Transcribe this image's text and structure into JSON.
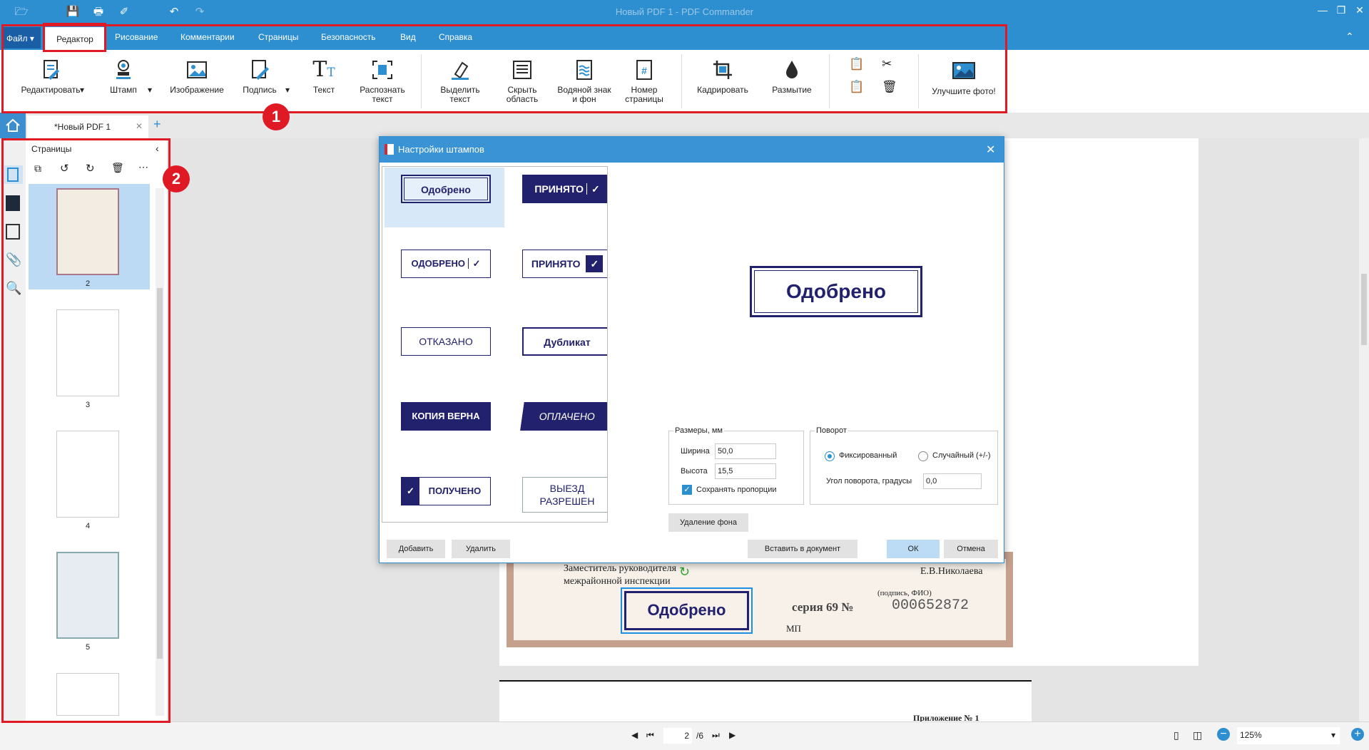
{
  "app": {
    "title": "Новый PDF 1 - PDF Commander"
  },
  "menu": {
    "file": "Файл",
    "items": [
      "Редактор",
      "Рисование",
      "Комментарии",
      "Страницы",
      "Безопасность",
      "Вид",
      "Справка"
    ]
  },
  "ribbon": {
    "edit": "Редактировать",
    "stamp": "Штамп",
    "image": "Изображение",
    "signature": "Подпись",
    "text": "Текст",
    "ocr": [
      "Распознать",
      "текст"
    ],
    "highlight": [
      "Выделить",
      "текст"
    ],
    "hide": [
      "Скрыть",
      "область"
    ],
    "watermark": [
      "Водяной знак",
      "и фон"
    ],
    "pagenum": [
      "Номер",
      "страницы"
    ],
    "crop": "Кадрировать",
    "blur": "Размытие",
    "enhance": "Улучшите фото!"
  },
  "annotations": {
    "one": "1",
    "two": "2"
  },
  "tab": {
    "name": "*Новый PDF 1"
  },
  "panel": {
    "title": "Страницы",
    "pages": [
      "2",
      "3",
      "4",
      "5"
    ]
  },
  "dialog": {
    "title": "Настройки штампов",
    "stamps": [
      "Одобрено",
      "ПРИНЯТО",
      "ОДОБРЕНО",
      "ПРИНЯТО",
      "ОТКАЗАНО",
      "Дубликат",
      "КОПИЯ ВЕРНА",
      "ОПЛАЧЕНО",
      "ПОЛУЧЕНО",
      "ВЫЕЗД РАЗРЕШЕН"
    ],
    "preview": "Одобрено",
    "sizes": {
      "legend": "Размеры, мм",
      "width_label": "Ширина",
      "width": "50,0",
      "height_label": "Высота",
      "height": "15,5",
      "keep": "Сохранять пропорции",
      "keep_checked": true
    },
    "rotation": {
      "legend": "Поворот",
      "fixed": "Фиксированный",
      "random": "Случайный (+/-)",
      "angle_label": "Угол поворота, градусы",
      "angle": "0,0",
      "selected": "fixed"
    },
    "buttons": {
      "remove_bg": "Удаление фона",
      "add": "Добавить",
      "delete": "Удалить",
      "insert": "Вставить в документ",
      "ok": "ОК",
      "cancel": "Отмена"
    }
  },
  "document": {
    "line1": "Заместитель руководителя",
    "line2": "межрайонной инспекции",
    "name": "Е.В.Николаева",
    "sig_hint": "(подпись, ФИО)",
    "seria": "серия 69 №",
    "number": "000652872",
    "mp": "МП",
    "placed_stamp": "Одобрено",
    "appendix": "Приложение № 1"
  },
  "status": {
    "page": "2",
    "total": "/6",
    "zoom": "125%"
  },
  "colors": {
    "accent": "#2e8fd0",
    "stamp": "#22216e",
    "annotation": "#e01a25"
  }
}
